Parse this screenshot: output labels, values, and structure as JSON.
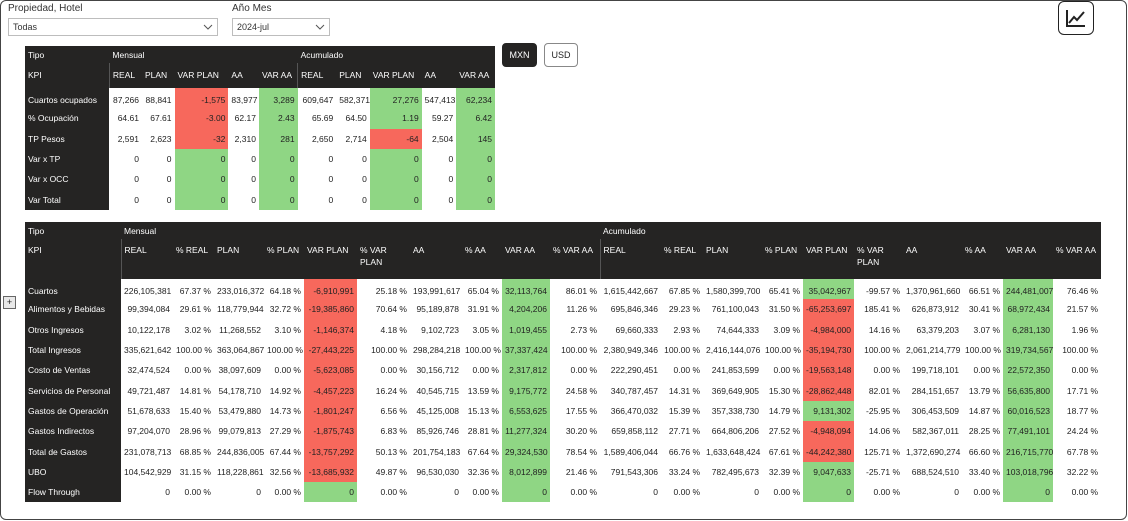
{
  "filters": {
    "hotel": {
      "title": "Propiedad, Hotel",
      "value": "Todas"
    },
    "period": {
      "title": "Año Mes",
      "value": "2024-jul"
    }
  },
  "currency": {
    "mxn": "MXN",
    "usd": "USD",
    "selected": "MXN"
  },
  "chart_button_icon": "line-chart-icon",
  "expand_button": "+",
  "colors": {
    "header_bg": "#252423",
    "negative": "#f7685c",
    "positive": "#8fd684"
  },
  "kpi_table": {
    "corner": {
      "tipo": "Tipo",
      "kpi": "KPI"
    },
    "groups": [
      "Mensual",
      "Acumulado"
    ],
    "columns": [
      "REAL",
      "PLAN",
      "VAR PLAN",
      "AA",
      "VAR AA"
    ],
    "rows": [
      {
        "label": "Cuartos ocupados",
        "mensual": [
          "87,266",
          "88,841",
          "-1,575",
          "83,977",
          "3,289"
        ],
        "acumulado": [
          "609,647",
          "582,371",
          "27,276",
          "547,413",
          "62,234"
        ]
      },
      {
        "label": "% Ocupación",
        "mensual": [
          "64.61",
          "67.61",
          "-3.00",
          "62.17",
          "2.43"
        ],
        "acumulado": [
          "65.69",
          "64.50",
          "1.19",
          "59.27",
          "6.42"
        ]
      },
      {
        "label": "TP Pesos",
        "mensual": [
          "2,591",
          "2,623",
          "-32",
          "2,310",
          "281"
        ],
        "acumulado": [
          "2,650",
          "2,714",
          "-64",
          "2,504",
          "145"
        ]
      },
      {
        "label": "Var x TP",
        "mensual": [
          "0",
          "0",
          "0",
          "0",
          "0"
        ],
        "acumulado": [
          "0",
          "0",
          "0",
          "0",
          "0"
        ]
      },
      {
        "label": "Var x OCC",
        "mensual": [
          "0",
          "0",
          "0",
          "0",
          "0"
        ],
        "acumulado": [
          "0",
          "0",
          "0",
          "0",
          "0"
        ]
      },
      {
        "label": "Var Total",
        "mensual": [
          "0",
          "0",
          "0",
          "0",
          "0"
        ],
        "acumulado": [
          "0",
          "0",
          "0",
          "0",
          "0"
        ]
      }
    ]
  },
  "pl_table": {
    "corner": {
      "tipo": "Tipo",
      "kpi": "KPI"
    },
    "groups": [
      "Mensual",
      "Acumulado"
    ],
    "columns": [
      "REAL",
      "% REAL",
      "PLAN",
      "% PLAN",
      "VAR PLAN",
      "% VAR PLAN",
      "AA",
      "% AA",
      "VAR AA",
      "% VAR AA"
    ],
    "rows": [
      {
        "label": "Cuartos",
        "mensual": [
          "226,105,381",
          "67.37 %",
          "233,016,372",
          "64.18 %",
          "-6,910,991",
          "25.18 %",
          "193,991,617",
          "65.04 %",
          "32,113,764",
          "86.01 %"
        ],
        "acumulado": [
          "1,615,442,667",
          "67.85 %",
          "1,580,399,700",
          "65.41 %",
          "35,042,967",
          "-99.57 %",
          "1,370,961,660",
          "66.51 %",
          "244,481,007",
          "76.46 %"
        ]
      },
      {
        "label": "Alimentos y Bebidas",
        "mensual": [
          "99,394,084",
          "29.61 %",
          "118,779,944",
          "32.72 %",
          "-19,385,860",
          "70.64 %",
          "95,189,878",
          "31.91 %",
          "4,204,206",
          "11.26 %"
        ],
        "acumulado": [
          "695,846,346",
          "29.23 %",
          "761,100,043",
          "31.50 %",
          "-65,253,697",
          "185.41 %",
          "626,873,912",
          "30.41 %",
          "68,972,434",
          "21.57 %"
        ]
      },
      {
        "label": "Otros Ingresos",
        "mensual": [
          "10,122,178",
          "3.02 %",
          "11,268,552",
          "3.10 %",
          "-1,146,374",
          "4.18 %",
          "9,102,723",
          "3.05 %",
          "1,019,455",
          "2.73 %"
        ],
        "acumulado": [
          "69,660,333",
          "2.93 %",
          "74,644,333",
          "3.09 %",
          "-4,984,000",
          "14.16 %",
          "63,379,203",
          "3.07 %",
          "6,281,130",
          "1.96 %"
        ]
      },
      {
        "label": "Total Ingresos",
        "mensual": [
          "335,621,642",
          "100.00 %",
          "363,064,867",
          "100.00 %",
          "-27,443,225",
          "100.00 %",
          "298,284,218",
          "100.00 %",
          "37,337,424",
          "100.00 %"
        ],
        "acumulado": [
          "2,380,949,346",
          "100.00 %",
          "2,416,144,076",
          "100.00 %",
          "-35,194,730",
          "100.00 %",
          "2,061,214,779",
          "100.00 %",
          "319,734,567",
          "100.00 %"
        ]
      },
      {
        "label": "Costo de Ventas",
        "mensual": [
          "32,474,524",
          "0.00 %",
          "38,097,609",
          "0.00 %",
          "-5,623,085",
          "0.00 %",
          "30,156,712",
          "0.00 %",
          "2,317,812",
          "0.00 %"
        ],
        "acumulado": [
          "222,290,451",
          "0.00 %",
          "241,853,599",
          "0.00 %",
          "-19,563,148",
          "0.00 %",
          "199,718,101",
          "0.00 %",
          "22,572,350",
          "0.00 %"
        ]
      },
      {
        "label": "Servicios de Personal",
        "mensual": [
          "49,721,487",
          "14.81 %",
          "54,178,710",
          "14.92 %",
          "-4,457,223",
          "16.24 %",
          "40,545,715",
          "13.59 %",
          "9,175,772",
          "24.58 %"
        ],
        "acumulado": [
          "340,787,457",
          "14.31 %",
          "369,649,905",
          "15.30 %",
          "-28,862,448",
          "82.01 %",
          "284,151,657",
          "13.79 %",
          "56,635,800",
          "17.71 %"
        ]
      },
      {
        "label": "Gastos de Operación",
        "mensual": [
          "51,678,633",
          "15.40 %",
          "53,479,880",
          "14.73 %",
          "-1,801,247",
          "6.56 %",
          "45,125,008",
          "15.13 %",
          "6,553,625",
          "17.55 %"
        ],
        "acumulado": [
          "366,470,032",
          "15.39 %",
          "357,338,730",
          "14.79 %",
          "9,131,302",
          "-25.95 %",
          "306,453,509",
          "14.87 %",
          "60,016,523",
          "18.77 %"
        ]
      },
      {
        "label": "Gastos Indirectos",
        "mensual": [
          "97,204,070",
          "28.96 %",
          "99,079,813",
          "27.29 %",
          "-1,875,743",
          "6.83 %",
          "85,926,746",
          "28.81 %",
          "11,277,324",
          "30.20 %"
        ],
        "acumulado": [
          "659,858,112",
          "27.71 %",
          "664,806,206",
          "27.52 %",
          "-4,948,094",
          "14.06 %",
          "582,367,011",
          "28.25 %",
          "77,491,101",
          "24.24 %"
        ]
      },
      {
        "label": "Total de Gastos",
        "mensual": [
          "231,078,713",
          "68.85 %",
          "244,836,005",
          "67.44 %",
          "-13,757,292",
          "50.13 %",
          "201,754,183",
          "67.64 %",
          "29,324,530",
          "78.54 %"
        ],
        "acumulado": [
          "1,589,406,044",
          "66.76 %",
          "1,633,648,424",
          "67.61 %",
          "-44,242,380",
          "125.71 %",
          "1,372,690,274",
          "66.60 %",
          "216,715,770",
          "67.78 %"
        ]
      },
      {
        "label": "UBO",
        "mensual": [
          "104,542,929",
          "31.15 %",
          "118,228,861",
          "32.56 %",
          "-13,685,932",
          "49.87 %",
          "96,530,030",
          "32.36 %",
          "8,012,899",
          "21.46 %"
        ],
        "acumulado": [
          "791,543,306",
          "33.24 %",
          "782,495,673",
          "32.39 %",
          "9,047,633",
          "-25.71 %",
          "688,524,510",
          "33.40 %",
          "103,018,796",
          "32.22 %"
        ]
      },
      {
        "label": "Flow Through",
        "mensual": [
          "0",
          "0.00 %",
          "0",
          "0.00 %",
          "0",
          "0.00 %",
          "0",
          "0.00 %",
          "0",
          "0.00 %"
        ],
        "acumulado": [
          "0",
          "0.00 %",
          "0",
          "0.00 %",
          "0",
          "0.00 %",
          "0",
          "0.00 %",
          "0",
          "0.00 %"
        ]
      }
    ]
  }
}
